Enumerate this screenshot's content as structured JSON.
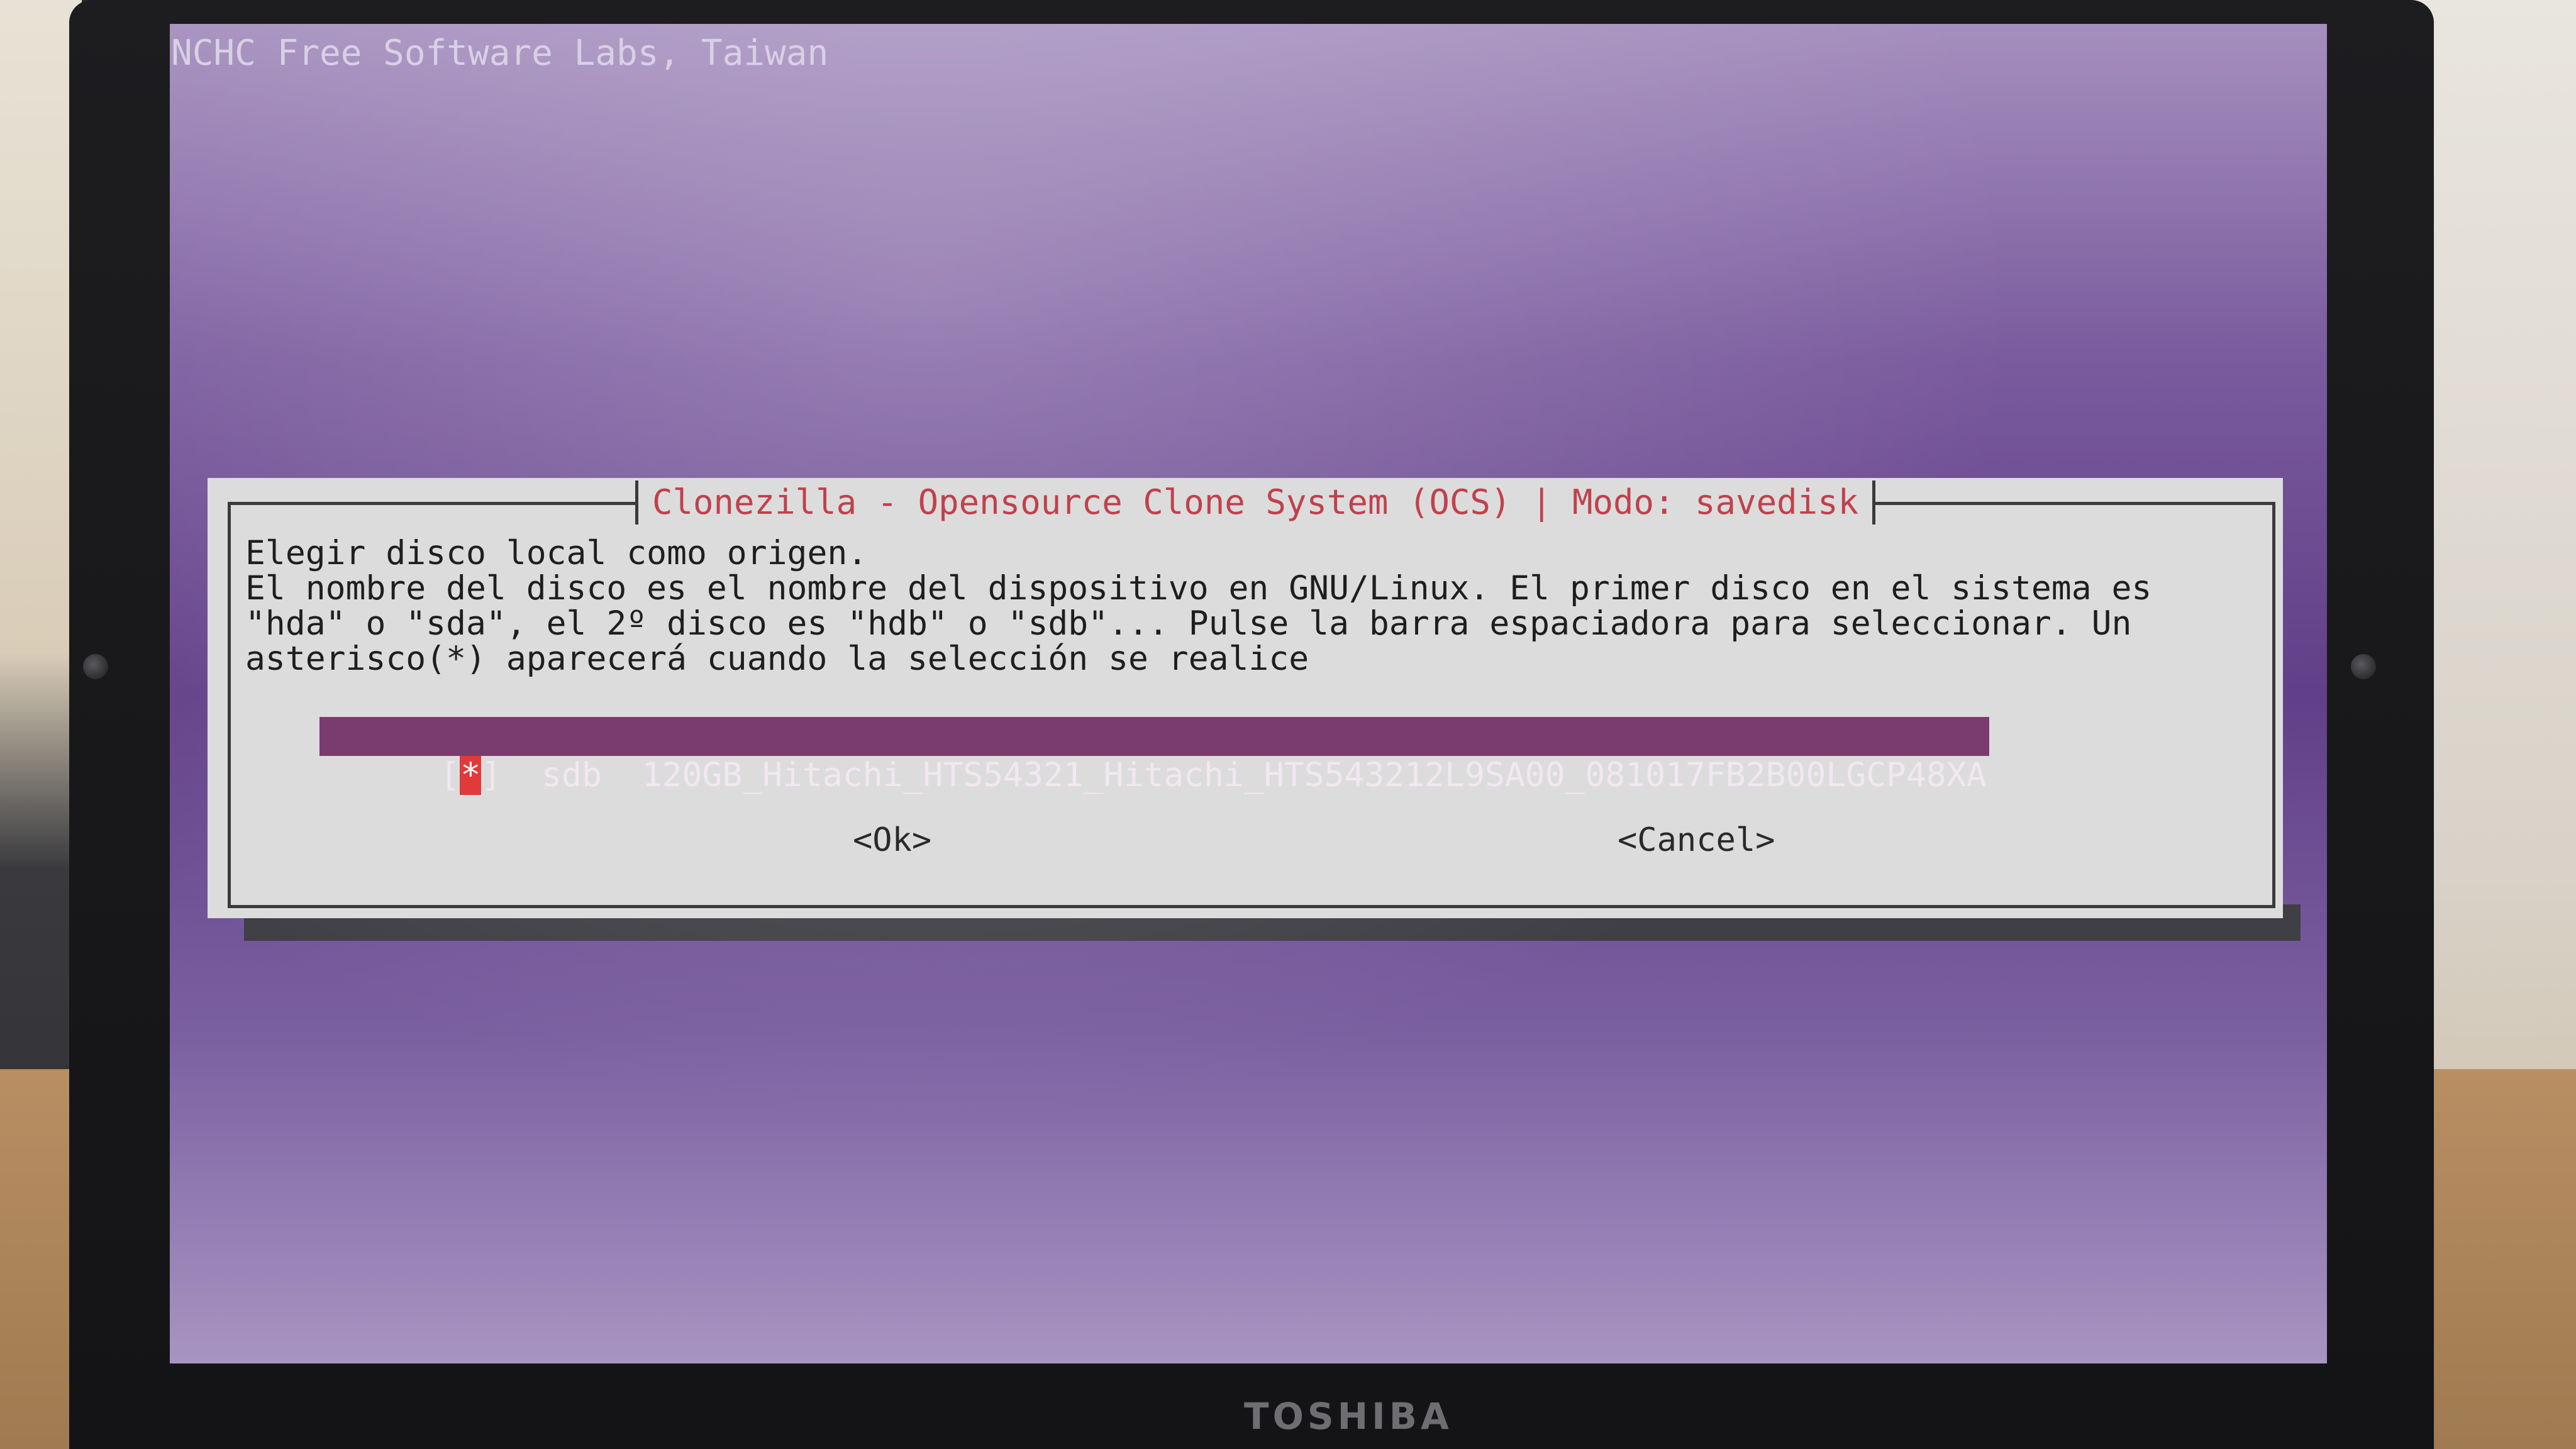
{
  "screen": {
    "banner": "NCHC Free Software Labs, Taiwan"
  },
  "dialog": {
    "title": "Clonezilla - Opensource Clone System (OCS) | Modo: savedisk",
    "line1": "Elegir disco local como origen.",
    "line2": "El nombre del disco es el nombre del dispositivo en GNU/Linux. El primer disco en el sistema es \"hda\" o \"sda\", el 2º disco es \"hdb\" o \"sdb\"... Pulse la barra espaciadora para seleccionar. Un asterisco(*) aparecerá cuando la selección se realice",
    "disk_list": [
      {
        "bracket_open": "[",
        "mark": "*",
        "bracket_close": "]",
        "device": "sdb",
        "description": "120GB_Hitachi_HTS54321_Hitachi_HTS543212L9SA00_081017FB2B00LGCP48XA",
        "selected": true
      }
    ],
    "ok_label": "<Ok>",
    "cancel_label": "<Cancel>"
  },
  "hardware": {
    "brand": "TOSHIBA"
  },
  "colors": {
    "screen_purple": "#7a5b9e",
    "dialog_bg": "#dcdcdc",
    "title_red": "#c0414c",
    "selection_bg": "#7a3b6e",
    "check_red": "#e03a3a"
  }
}
